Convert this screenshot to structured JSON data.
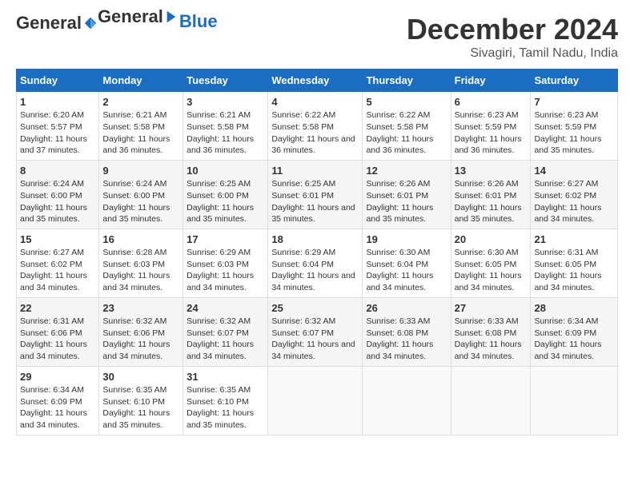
{
  "logo": {
    "general": "General",
    "blue": "Blue"
  },
  "title": "December 2024",
  "subtitle": "Sivagiri, Tamil Nadu, India",
  "days_of_week": [
    "Sunday",
    "Monday",
    "Tuesday",
    "Wednesday",
    "Thursday",
    "Friday",
    "Saturday"
  ],
  "weeks": [
    [
      {
        "day": "1",
        "sunrise": "6:20 AM",
        "sunset": "5:57 PM",
        "daylight": "11 hours and 37 minutes."
      },
      {
        "day": "2",
        "sunrise": "6:21 AM",
        "sunset": "5:58 PM",
        "daylight": "11 hours and 36 minutes."
      },
      {
        "day": "3",
        "sunrise": "6:21 AM",
        "sunset": "5:58 PM",
        "daylight": "11 hours and 36 minutes."
      },
      {
        "day": "4",
        "sunrise": "6:22 AM",
        "sunset": "5:58 PM",
        "daylight": "11 hours and 36 minutes."
      },
      {
        "day": "5",
        "sunrise": "6:22 AM",
        "sunset": "5:58 PM",
        "daylight": "11 hours and 36 minutes."
      },
      {
        "day": "6",
        "sunrise": "6:23 AM",
        "sunset": "5:59 PM",
        "daylight": "11 hours and 36 minutes."
      },
      {
        "day": "7",
        "sunrise": "6:23 AM",
        "sunset": "5:59 PM",
        "daylight": "11 hours and 35 minutes."
      }
    ],
    [
      {
        "day": "8",
        "sunrise": "6:24 AM",
        "sunset": "6:00 PM",
        "daylight": "11 hours and 35 minutes."
      },
      {
        "day": "9",
        "sunrise": "6:24 AM",
        "sunset": "6:00 PM",
        "daylight": "11 hours and 35 minutes."
      },
      {
        "day": "10",
        "sunrise": "6:25 AM",
        "sunset": "6:00 PM",
        "daylight": "11 hours and 35 minutes."
      },
      {
        "day": "11",
        "sunrise": "6:25 AM",
        "sunset": "6:01 PM",
        "daylight": "11 hours and 35 minutes."
      },
      {
        "day": "12",
        "sunrise": "6:26 AM",
        "sunset": "6:01 PM",
        "daylight": "11 hours and 35 minutes."
      },
      {
        "day": "13",
        "sunrise": "6:26 AM",
        "sunset": "6:01 PM",
        "daylight": "11 hours and 35 minutes."
      },
      {
        "day": "14",
        "sunrise": "6:27 AM",
        "sunset": "6:02 PM",
        "daylight": "11 hours and 34 minutes."
      }
    ],
    [
      {
        "day": "15",
        "sunrise": "6:27 AM",
        "sunset": "6:02 PM",
        "daylight": "11 hours and 34 minutes."
      },
      {
        "day": "16",
        "sunrise": "6:28 AM",
        "sunset": "6:03 PM",
        "daylight": "11 hours and 34 minutes."
      },
      {
        "day": "17",
        "sunrise": "6:29 AM",
        "sunset": "6:03 PM",
        "daylight": "11 hours and 34 minutes."
      },
      {
        "day": "18",
        "sunrise": "6:29 AM",
        "sunset": "6:04 PM",
        "daylight": "11 hours and 34 minutes."
      },
      {
        "day": "19",
        "sunrise": "6:30 AM",
        "sunset": "6:04 PM",
        "daylight": "11 hours and 34 minutes."
      },
      {
        "day": "20",
        "sunrise": "6:30 AM",
        "sunset": "6:05 PM",
        "daylight": "11 hours and 34 minutes."
      },
      {
        "day": "21",
        "sunrise": "6:31 AM",
        "sunset": "6:05 PM",
        "daylight": "11 hours and 34 minutes."
      }
    ],
    [
      {
        "day": "22",
        "sunrise": "6:31 AM",
        "sunset": "6:06 PM",
        "daylight": "11 hours and 34 minutes."
      },
      {
        "day": "23",
        "sunrise": "6:32 AM",
        "sunset": "6:06 PM",
        "daylight": "11 hours and 34 minutes."
      },
      {
        "day": "24",
        "sunrise": "6:32 AM",
        "sunset": "6:07 PM",
        "daylight": "11 hours and 34 minutes."
      },
      {
        "day": "25",
        "sunrise": "6:32 AM",
        "sunset": "6:07 PM",
        "daylight": "11 hours and 34 minutes."
      },
      {
        "day": "26",
        "sunrise": "6:33 AM",
        "sunset": "6:08 PM",
        "daylight": "11 hours and 34 minutes."
      },
      {
        "day": "27",
        "sunrise": "6:33 AM",
        "sunset": "6:08 PM",
        "daylight": "11 hours and 34 minutes."
      },
      {
        "day": "28",
        "sunrise": "6:34 AM",
        "sunset": "6:09 PM",
        "daylight": "11 hours and 34 minutes."
      }
    ],
    [
      {
        "day": "29",
        "sunrise": "6:34 AM",
        "sunset": "6:09 PM",
        "daylight": "11 hours and 34 minutes."
      },
      {
        "day": "30",
        "sunrise": "6:35 AM",
        "sunset": "6:10 PM",
        "daylight": "11 hours and 35 minutes."
      },
      {
        "day": "31",
        "sunrise": "6:35 AM",
        "sunset": "6:10 PM",
        "daylight": "11 hours and 35 minutes."
      },
      null,
      null,
      null,
      null
    ]
  ],
  "labels": {
    "sunrise": "Sunrise:",
    "sunset": "Sunset:",
    "daylight": "Daylight:"
  }
}
